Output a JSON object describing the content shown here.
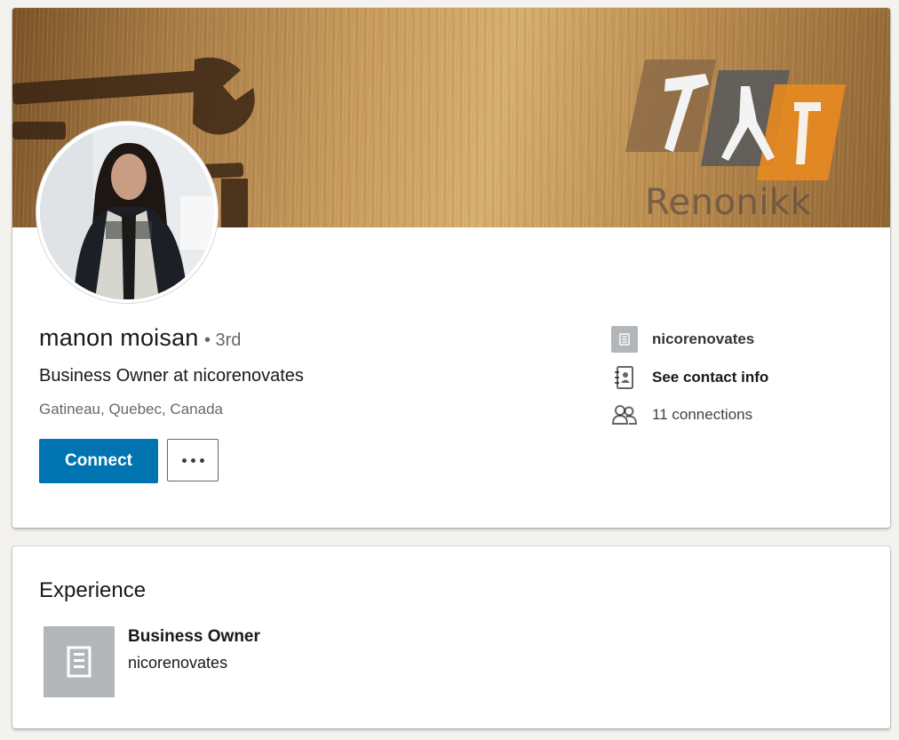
{
  "profile": {
    "banner_brand_text": "Renonikk",
    "name": "manon moisan",
    "degree": "• 3rd",
    "headline": "Business Owner at nicorenovates",
    "location": "Gatineau, Quebec, Canada"
  },
  "actions": {
    "connect_label": "Connect",
    "more_label": "···"
  },
  "sidebar": {
    "company": "nicorenovates",
    "contact_info": "See contact info",
    "connections": "11 connections"
  },
  "experience": {
    "title": "Experience",
    "items": [
      {
        "role": "Business Owner",
        "company": "nicorenovates"
      }
    ]
  },
  "colors": {
    "primary_button": "#0073b1",
    "page_background": "#f3f2ef",
    "logo_placeholder": "#b3b6b9"
  },
  "icons": [
    "company-logo-icon",
    "contact-card-icon",
    "people-icon",
    "building-icon"
  ]
}
